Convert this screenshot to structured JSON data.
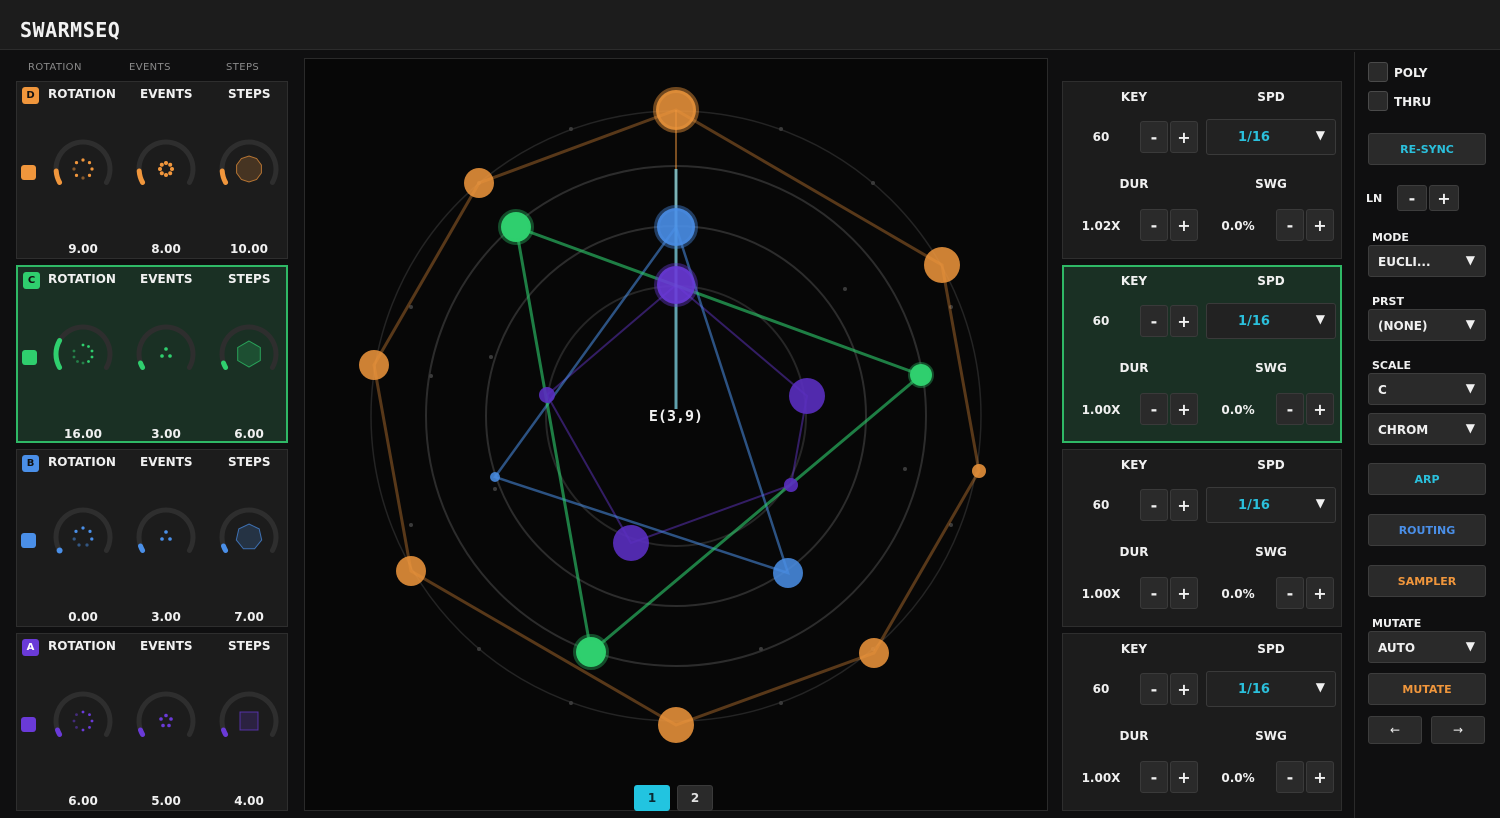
{
  "app": {
    "title": "SWARMSEQ"
  },
  "column_headers": [
    "ROTATION",
    "EVENTS",
    "STEPS"
  ],
  "tracks": [
    {
      "id": "D",
      "color": "#f0963c",
      "labels": [
        "ROTATION",
        "EVENTS",
        "STEPS"
      ],
      "rotation": "9.00",
      "events": "8.00",
      "steps": "10.00",
      "active": false
    },
    {
      "id": "C",
      "color": "#2fcf6e",
      "labels": [
        "ROTATION",
        "EVENTS",
        "STEPS"
      ],
      "rotation": "16.00",
      "events": "3.00",
      "steps": "6.00",
      "active": true
    },
    {
      "id": "B",
      "color": "#4a8fe8",
      "labels": [
        "ROTATION",
        "EVENTS",
        "STEPS"
      ],
      "rotation": "0.00",
      "events": "3.00",
      "steps": "7.00",
      "active": false
    },
    {
      "id": "A",
      "color": "#6a3ad8",
      "labels": [
        "ROTATION",
        "EVENTS",
        "STEPS"
      ],
      "rotation": "6.00",
      "events": "5.00",
      "steps": "4.00",
      "active": false
    }
  ],
  "visualizer": {
    "pattern_label": "E(3,9)",
    "pages": [
      "1",
      "2"
    ],
    "active_page": "1"
  },
  "params": [
    {
      "key_label": "KEY",
      "spd_label": "SPD",
      "key": "60",
      "spd": "1/16",
      "dur_label": "DUR",
      "swg_label": "SWG",
      "dur": "1.02X",
      "swg": "0.0%",
      "active": false
    },
    {
      "key_label": "KEY",
      "spd_label": "SPD",
      "key": "60",
      "spd": "1/16",
      "dur_label": "DUR",
      "swg_label": "SWG",
      "dur": "1.00X",
      "swg": "0.0%",
      "active": true
    },
    {
      "key_label": "KEY",
      "spd_label": "SPD",
      "key": "60",
      "spd": "1/16",
      "dur_label": "DUR",
      "swg_label": "SWG",
      "dur": "1.00X",
      "swg": "0.0%",
      "active": false
    },
    {
      "key_label": "KEY",
      "spd_label": "SPD",
      "key": "60",
      "spd": "1/16",
      "dur_label": "DUR",
      "swg_label": "SWG",
      "dur": "1.00X",
      "swg": "0.0%",
      "active": false
    }
  ],
  "buttons": {
    "minus": "-",
    "plus": "+",
    "dropdown_arrow": "▼"
  },
  "sidebar": {
    "poly_label": "POLY",
    "thru_label": "THRU",
    "resync_label": "RE-SYNC",
    "ln_label": "LN",
    "mode_label": "MODE",
    "mode_value": "EUCLI...",
    "prst_label": "PRST",
    "prst_value": "(NONE)",
    "scale_label": "SCALE",
    "scale_value": "C",
    "scale_type": "CHROM",
    "arp_label": "ARP",
    "routing_label": "ROUTING",
    "sampler_label": "SAMPLER",
    "mutate_label": "MUTATE",
    "mutate_value": "AUTO",
    "mutate_button": "MUTATE",
    "prev_label": "←",
    "next_label": "→"
  },
  "colors": {
    "accent_cyan": "#2bc0dc",
    "routing_blue": "#4a8fe8",
    "sampler_orange": "#f0963c",
    "active_green": "#2fb866"
  }
}
